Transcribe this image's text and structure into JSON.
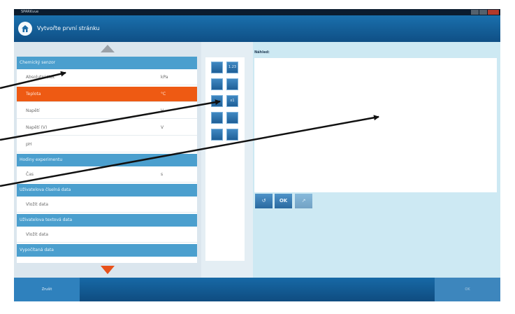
{
  "window": {
    "app_title": "SPARKvue"
  },
  "header": {
    "title": "Vytvořte první stránku"
  },
  "sensor_list": {
    "sections": [
      {
        "title": "Chemický senzor",
        "items": [
          {
            "label": "Absolutní tlak",
            "unit": "kPa"
          },
          {
            "label": "Teplota",
            "unit": "°C",
            "selected": true
          },
          {
            "label": "Napětí",
            "unit": "V"
          },
          {
            "label": "Napětí (V)",
            "unit": "V"
          },
          {
            "label": "pH",
            "unit": ""
          }
        ]
      },
      {
        "title": "Hodiny experimentu",
        "items": [
          {
            "label": "Čas",
            "unit": "s"
          }
        ]
      },
      {
        "title": "Uživatelova číselná data",
        "items": [
          {
            "label": "Vložit data",
            "unit": ""
          }
        ]
      },
      {
        "title": "Uživatelova textová data",
        "items": [
          {
            "label": "Vložit data",
            "unit": ""
          }
        ]
      },
      {
        "title": "Vypočítaná data",
        "items": []
      }
    ]
  },
  "display_types": {
    "buttons": [
      {
        "icon": "graph-icon",
        "text": ""
      },
      {
        "icon": "digits-icon",
        "text": "1.23"
      },
      {
        "icon": "table-icon",
        "text": ""
      },
      {
        "icon": "meter-icon",
        "text": ""
      },
      {
        "icon": "bar-graph-icon",
        "text": ""
      },
      {
        "icon": "fft-icon",
        "text": "x1"
      },
      {
        "icon": "text-box-icon",
        "text": ""
      },
      {
        "icon": "note-icon",
        "text": ""
      },
      {
        "icon": "image-icon",
        "text": ""
      },
      {
        "icon": "movie-icon",
        "text": ""
      }
    ]
  },
  "preview": {
    "label": "Náhled:",
    "buttons": [
      {
        "icon": "undo-icon",
        "text": "↺"
      },
      {
        "icon": "ok-arrow-icon",
        "text": "OK"
      },
      {
        "icon": "clear-icon",
        "text": "↗"
      }
    ]
  },
  "footer": {
    "back_label": "Zrušit",
    "ok_label": "OK"
  },
  "colors": {
    "header_blue": "#1665a3",
    "section_blue": "#4b9fce",
    "selected_orange": "#ee5a13",
    "preview_background": "#cde9f3",
    "scroll_down_arrow": "#e8521b"
  }
}
